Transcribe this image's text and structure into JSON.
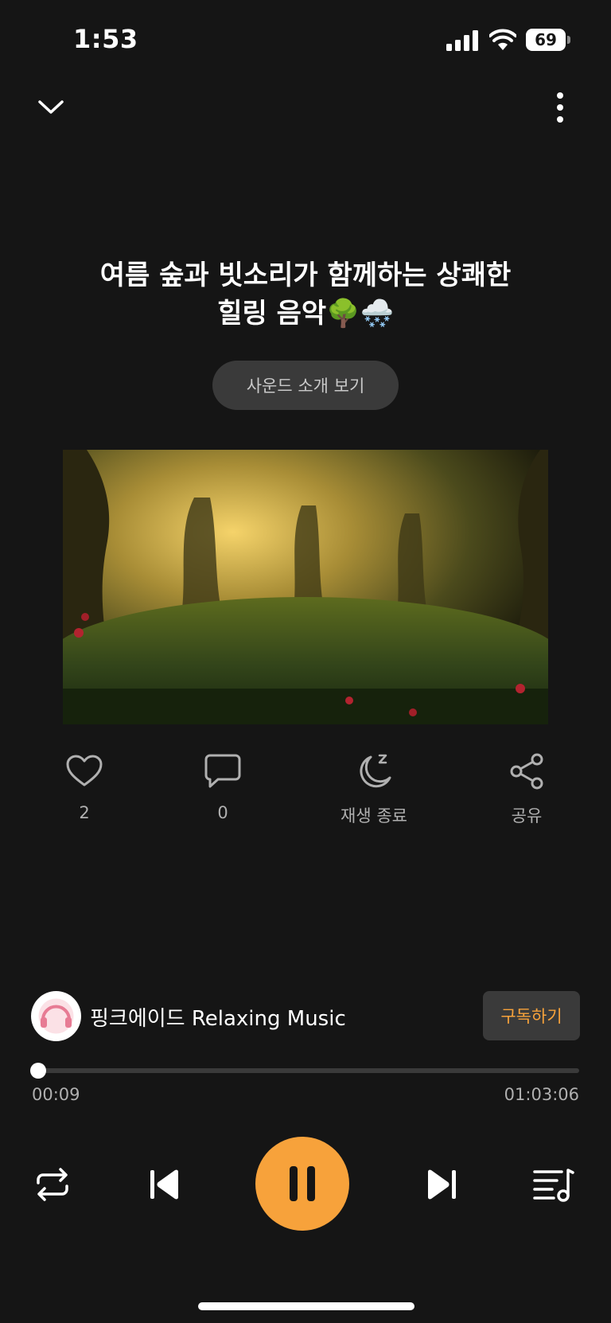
{
  "status_bar": {
    "time": "1:53",
    "battery": "69"
  },
  "track": {
    "title_line1": "여름 숲과 빗소리가 함께하는 상쾌한",
    "title_line2": "힐링 음악🌳🌨️",
    "intro_button": "사운드 소개 보기"
  },
  "actions": {
    "likes": "2",
    "comments": "0",
    "sleep_timer": "재생 종료",
    "share": "공유"
  },
  "channel": {
    "name": "핑크에이드 Relaxing Music",
    "subscribe": "구독하기"
  },
  "playback": {
    "elapsed": "00:09",
    "total": "01:03:06",
    "progress": 0.0024
  },
  "colors": {
    "background": "#151515",
    "accent": "#f7a23b",
    "button_bg": "#3a3a3a",
    "muted_text": "#b0b0b0"
  },
  "icons": {
    "collapse": "chevron-down-icon",
    "more": "more-vertical-icon",
    "like": "heart-icon",
    "comment": "comment-icon",
    "sleep": "moon-zzz-icon",
    "share": "share-icon",
    "repeat": "repeat-icon",
    "previous": "skip-previous-icon",
    "pause": "pause-icon",
    "next": "skip-next-icon",
    "playlist": "playlist-icon"
  }
}
